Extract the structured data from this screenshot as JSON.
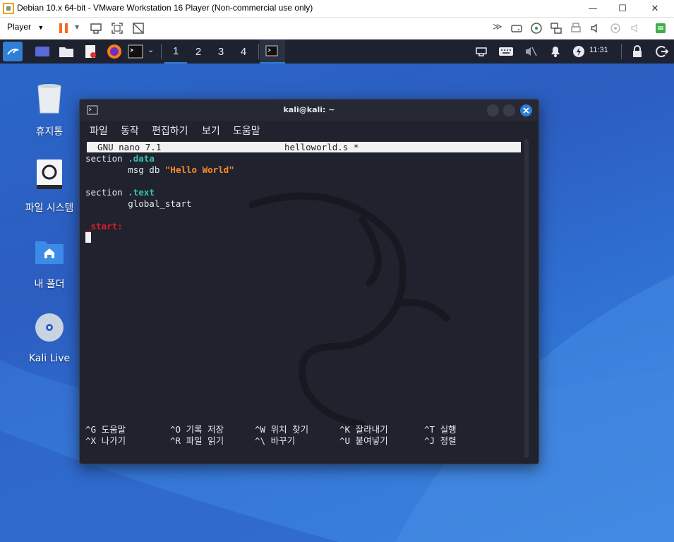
{
  "vmware": {
    "title": "Debian 10.x 64-bit - VMware Workstation 16 Player (Non-commercial use only)",
    "minimize": "—",
    "maximize": "☐",
    "close": "✕",
    "player_menu": "Player"
  },
  "panel": {
    "workspaces": [
      "1",
      "2",
      "3",
      "4"
    ],
    "active_workspace": "1",
    "clock": "11:31"
  },
  "desktop": {
    "icons": [
      {
        "label": "휴지통",
        "icon": "trash-icon"
      },
      {
        "label": "파일 시스템",
        "icon": "drive-icon"
      },
      {
        "label": "내 폴더",
        "icon": "home-folder-icon"
      },
      {
        "label": "Kali Live",
        "icon": "disc-icon"
      }
    ]
  },
  "terminal": {
    "title": "kali@kali: ~",
    "menu": [
      "파일",
      "동작",
      "편집하기",
      "보기",
      "도움말"
    ]
  },
  "nano": {
    "header_left": "  GNU nano 7.1",
    "header_file": "helloworld.s *",
    "lines": {
      "l1_a": "section ",
      "l1_b": ".data",
      "l2_a": "        msg db ",
      "l2_b": "\"Hello World\"",
      "l4_a": "section ",
      "l4_b": ".text",
      "l5": "        global_start",
      "l7": "_start:"
    },
    "shortcuts": [
      {
        "key": "^G",
        "label": "도움말"
      },
      {
        "key": "^O",
        "label": "기록 저장"
      },
      {
        "key": "^W",
        "label": "위치 찾기"
      },
      {
        "key": "^K",
        "label": "잘라내기"
      },
      {
        "key": "^T",
        "label": "실행"
      },
      {
        "key": "^X",
        "label": "나가기"
      },
      {
        "key": "^R",
        "label": "파일 읽기"
      },
      {
        "key": "^\\",
        "label": "바꾸기"
      },
      {
        "key": "^U",
        "label": "붙여넣기"
      },
      {
        "key": "^J",
        "label": "정렬"
      }
    ]
  },
  "colors": {
    "kali_panel": "#1e2230",
    "terminal_bg": "#20232e",
    "accent_blue": "#2f7fd6",
    "keyword_teal": "#37c0b8",
    "string_orange": "#ff8b2b",
    "label_red": "#e01b24"
  }
}
